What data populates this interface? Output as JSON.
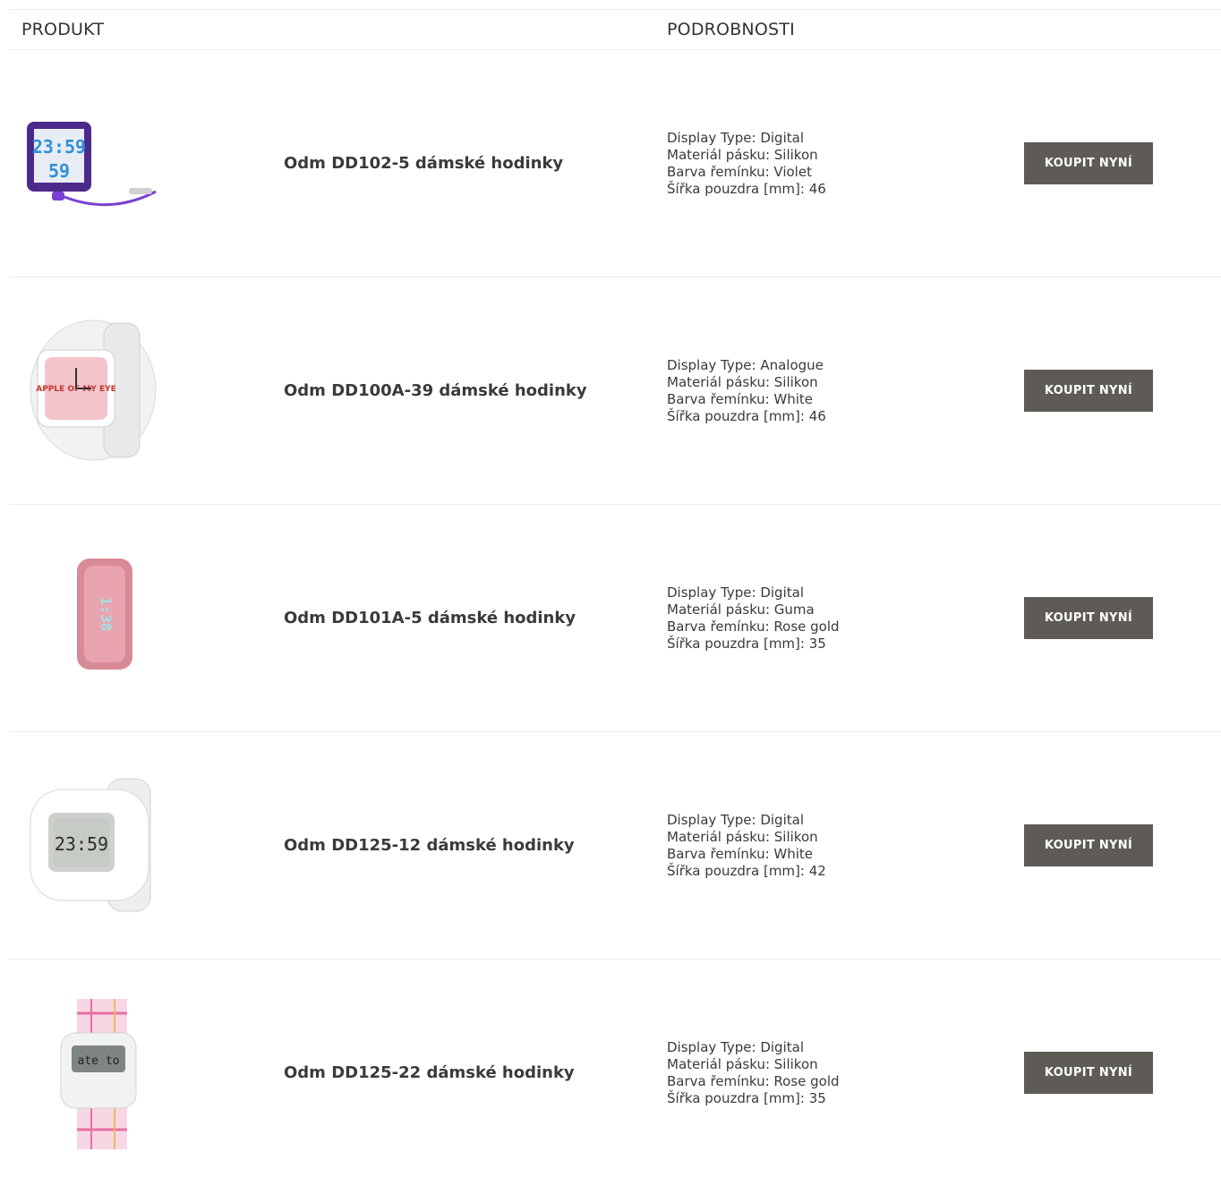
{
  "header": {
    "col_product": "PRODUKT",
    "col_details": "PODROBNOSTI"
  },
  "products": [
    {
      "name": "Odm DD102-5 dámské hodinky",
      "details": [
        "Display Type: Digital",
        "Materiál pásku: Silikon",
        "Barva řemínku: Violet",
        "Šířka pouzdra [mm]: 46"
      ],
      "buy_label": "KOUPIT NYNÍ",
      "image_icon": "violet-digital-watch-image",
      "watch_text": "23:59"
    },
    {
      "name": "Odm DD100A-39 dámské hodinky",
      "details": [
        "Display Type: Analogue",
        "Materiál pásku: Silikon",
        "Barva řemínku: White",
        "Šířka pouzdra [mm]: 46"
      ],
      "buy_label": "KOUPIT NYNÍ",
      "image_icon": "white-analogue-watch-image",
      "watch_text": "APPLE OF MY EYE"
    },
    {
      "name": "Odm DD101A-5 dámské hodinky",
      "details": [
        "Display Type: Digital",
        "Materiál pásku: Guma",
        "Barva řemínku: Rose gold",
        "Šířka pouzdra [mm]: 35"
      ],
      "buy_label": "KOUPIT NYNÍ",
      "image_icon": "rose-gold-digital-watch-image",
      "watch_text": "1:38"
    },
    {
      "name": "Odm DD125-12 dámské hodinky",
      "details": [
        "Display Type: Digital",
        "Materiál pásku: Silikon",
        "Barva řemínku: White",
        "Šířka pouzdra [mm]: 42"
      ],
      "buy_label": "KOUPIT NYNÍ",
      "image_icon": "white-digital-watch-image",
      "watch_text": "23:59"
    },
    {
      "name": "Odm DD125-22 dámské hodinky",
      "details": [
        "Display Type: Digital",
        "Materiál pásku: Silikon",
        "Barva řemínku: Rose gold",
        "Šířka pouzdra [mm]: 35"
      ],
      "buy_label": "KOUPIT NYNÍ",
      "image_icon": "plaid-digital-watch-image",
      "watch_text": "ate to"
    }
  ],
  "colors": {
    "button_bg": "#5e5a55",
    "border": "#ececec",
    "text": "#3a3a3a"
  }
}
